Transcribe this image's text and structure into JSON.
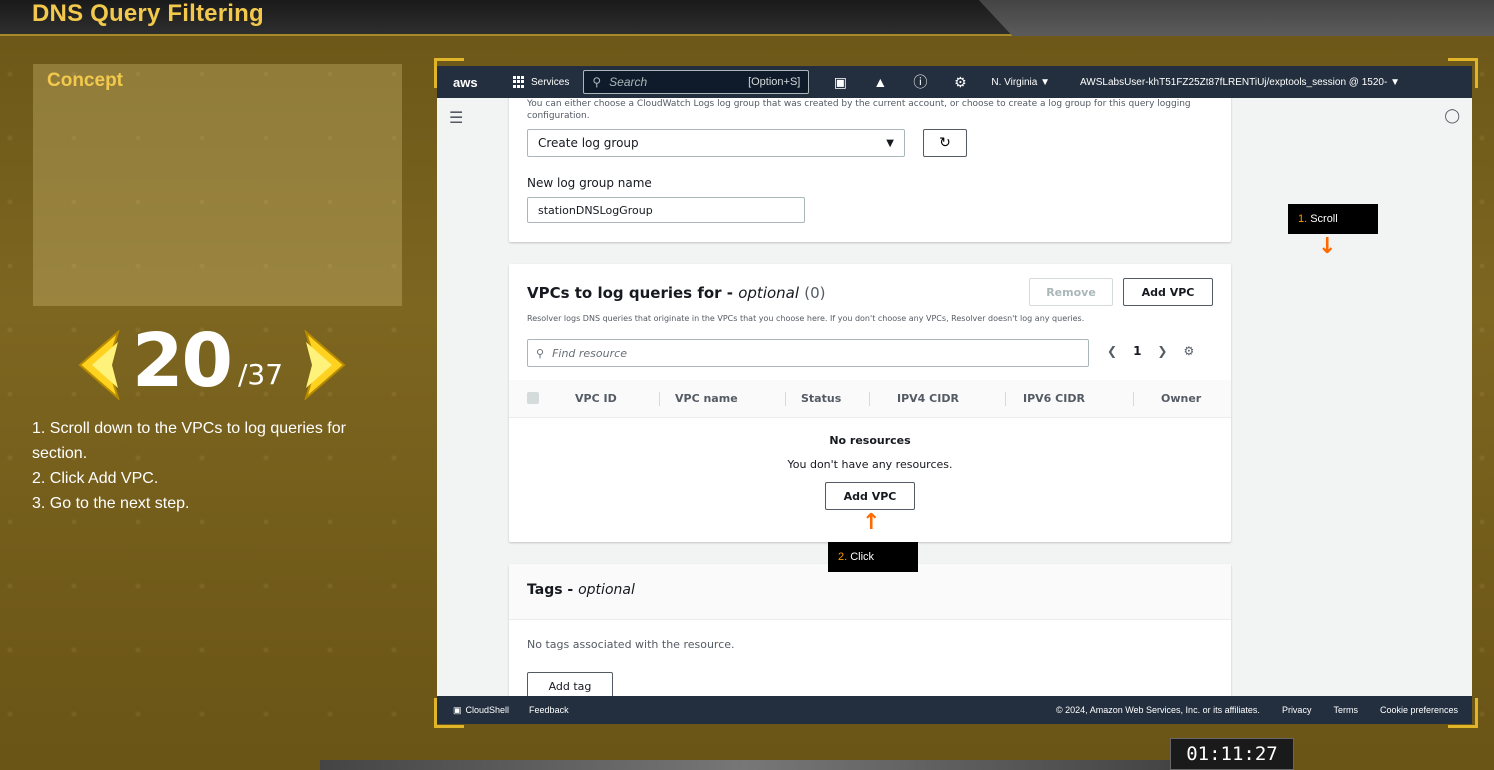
{
  "app": {
    "title": "DNS Query Filtering"
  },
  "concept": {
    "label": "Concept"
  },
  "pager": {
    "current": "20",
    "total": "/37"
  },
  "steps": {
    "line1": "1. Scroll down to the VPCs to log queries for",
    "line2": "section.",
    "line3": "2. Click Add VPC.",
    "line4": "3. Go to the next step."
  },
  "aws_nav": {
    "logo": "aws",
    "services": "Services",
    "search_placeholder": "Search",
    "search_shortcut": "[Option+S]",
    "region": "N. Virginia ▼",
    "account": "AWSLabsUser-khT51FZ25Zt87fLRENTiUj/exptools_session @ 1520- ▼"
  },
  "log_group": {
    "note": "You can either choose a CloudWatch Logs log group that was created by the current account, or choose to create a log group for this query logging configuration.",
    "select_value": "Create log group",
    "new_name_label": "New log group name",
    "new_name_value": "stationDNSLogGroup"
  },
  "vpcs": {
    "title": "VPCs to log queries for -",
    "optional": "optional",
    "count": "(0)",
    "remove_label": "Remove",
    "add_label": "Add VPC",
    "description": "Resolver logs DNS queries that originate in the VPCs that you choose here. If you don't choose any VPCs, Resolver doesn't log any queries.",
    "find_placeholder": "Find resource",
    "page": "1",
    "columns": [
      "VPC ID",
      "VPC name",
      "Status",
      "IPV4 CIDR",
      "IPV6 CIDR",
      "Owner"
    ],
    "empty_title": "No resources",
    "empty_sub": "You don't have any resources.",
    "empty_add_label": "Add VPC"
  },
  "tags": {
    "title": "Tags -",
    "optional": "optional",
    "empty": "No tags associated with the resource.",
    "add_label": "Add tag"
  },
  "hints": {
    "scroll_num": "1.",
    "scroll_text": "Scroll",
    "click_num": "2.",
    "click_text": "Click"
  },
  "footer": {
    "cloudshell": "CloudShell",
    "feedback": "Feedback",
    "copyright": "© 2024, Amazon Web Services, Inc. or its affiliates.",
    "privacy": "Privacy",
    "terms": "Terms",
    "cookies": "Cookie preferences"
  },
  "timer": "01:11:27",
  "colors": {
    "accent": "#f2c94c",
    "aws_nav": "#232f3e",
    "arrow": "#ff6a00",
    "hint_num": "#ff9900"
  }
}
